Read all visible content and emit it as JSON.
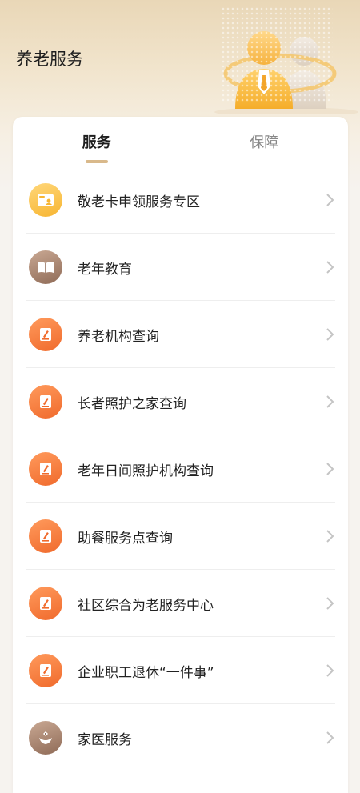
{
  "page": {
    "title": "养老服务"
  },
  "colors": {
    "accent": "#d9b98b",
    "orange": "#f06a2c",
    "yellow": "#f7b531",
    "brown": "#8f6b57"
  },
  "tabs": [
    {
      "label": "服务",
      "active": true
    },
    {
      "label": "保障",
      "active": false
    }
  ],
  "services": [
    {
      "label": "敬老卡申领服务专区",
      "icon": "card-icon",
      "color": "yellow"
    },
    {
      "label": "老年教育",
      "icon": "book-icon",
      "color": "brown"
    },
    {
      "label": "养老机构查询",
      "icon": "pen-icon",
      "color": "orange"
    },
    {
      "label": "长者照护之家查询",
      "icon": "pen-icon",
      "color": "orange"
    },
    {
      "label": "老年日间照护机构查询",
      "icon": "pen-icon",
      "color": "orange"
    },
    {
      "label": "助餐服务点查询",
      "icon": "pen-icon",
      "color": "orange"
    },
    {
      "label": "社区综合为老服务中心",
      "icon": "pen-icon",
      "color": "orange"
    },
    {
      "label": "企业职工退休“一件事”",
      "icon": "pen-icon",
      "color": "orange"
    },
    {
      "label": "家医服务",
      "icon": "medical-hands-icon",
      "color": "brown"
    }
  ]
}
